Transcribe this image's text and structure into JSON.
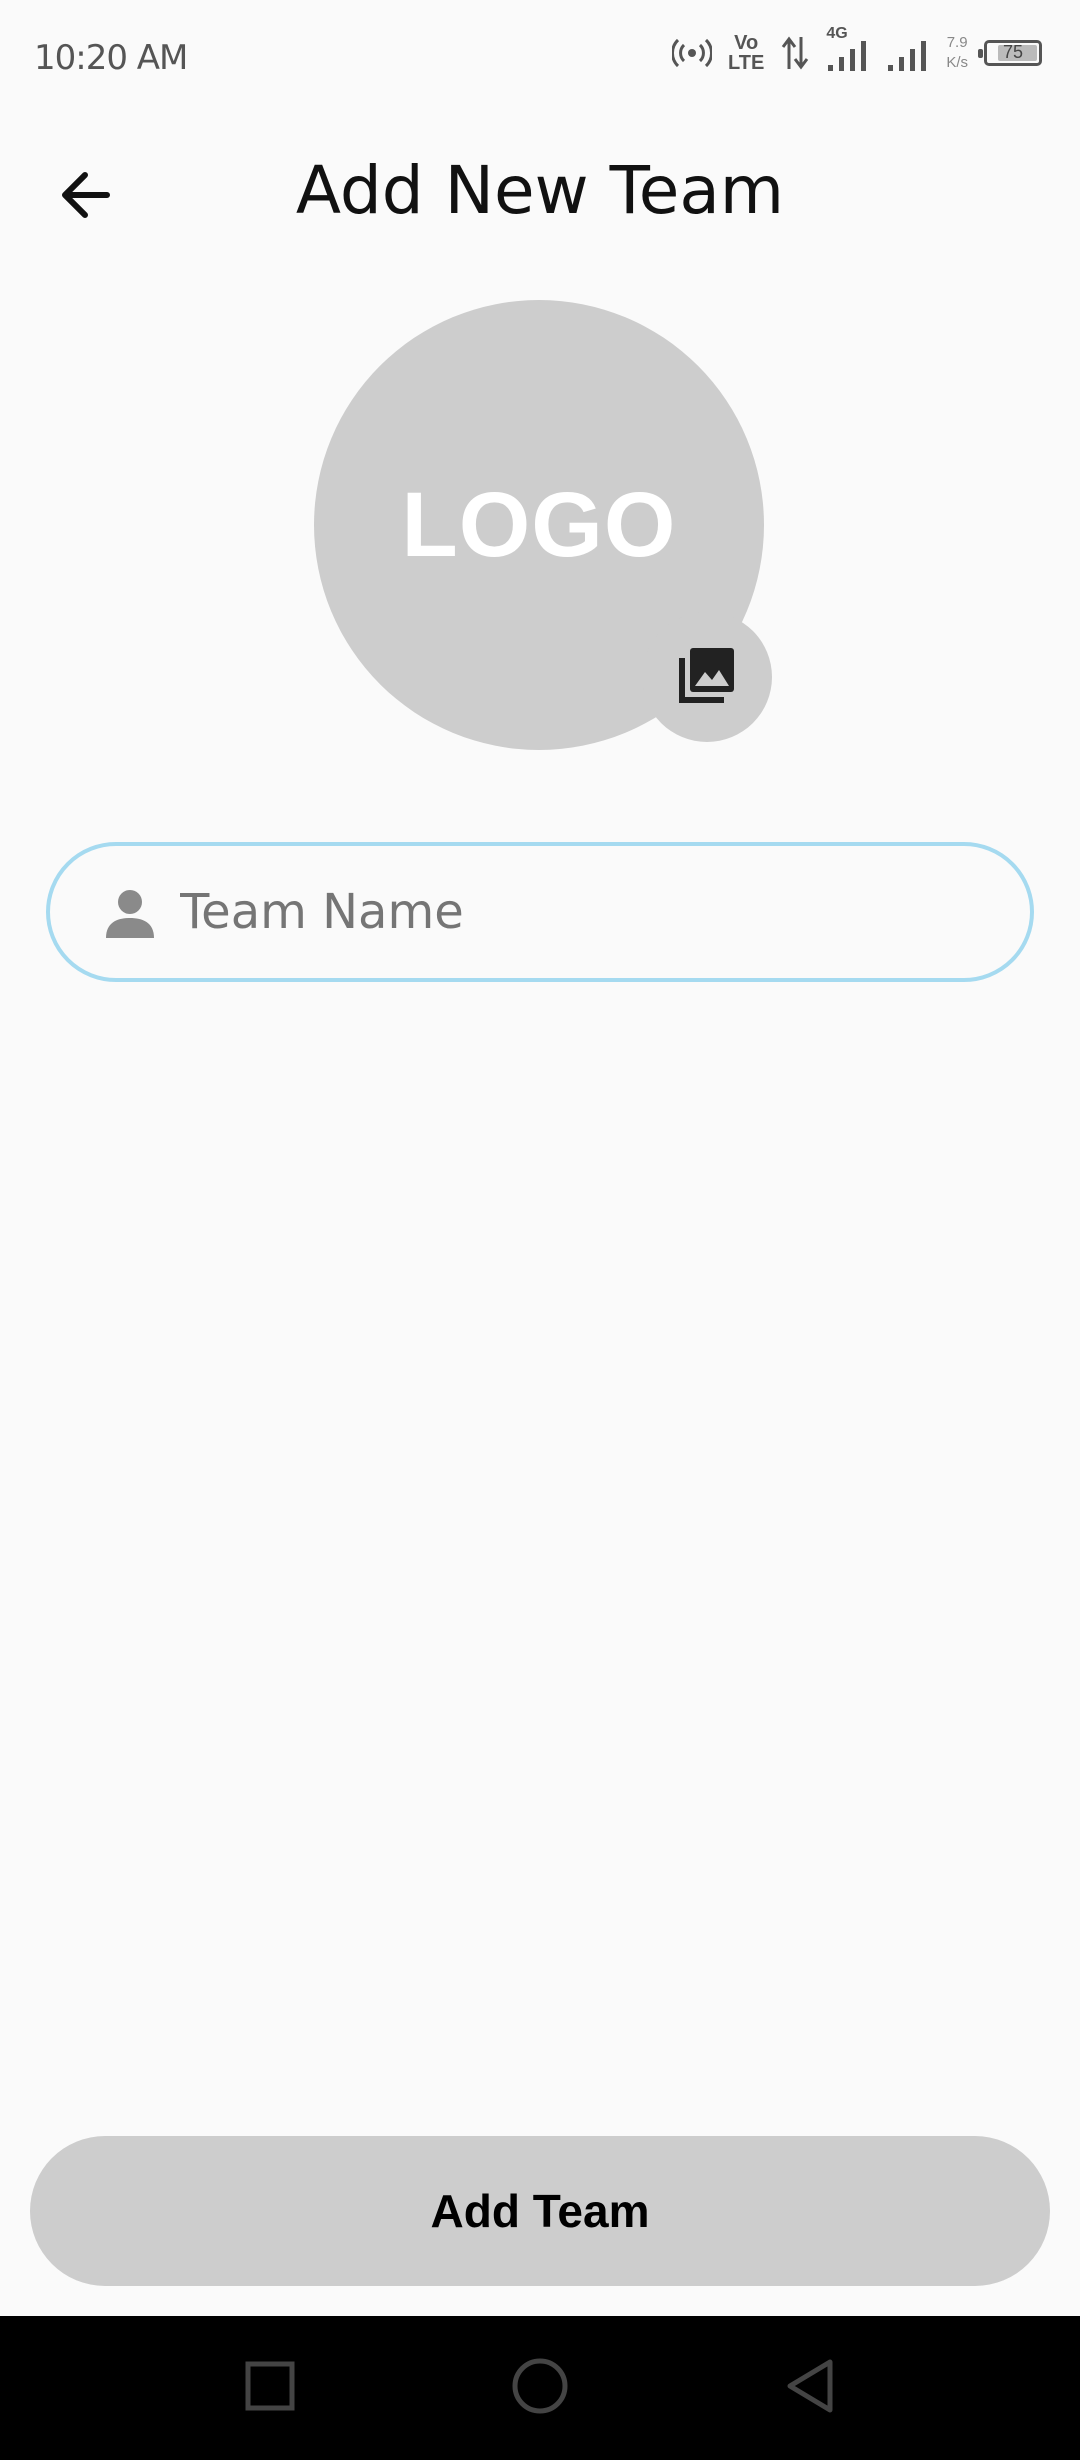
{
  "status_bar": {
    "time": "10:20 AM",
    "volte_top": "Vo",
    "volte_bottom": "LTE",
    "network": "4G",
    "speed_value": "7.9",
    "speed_unit": "K/s",
    "battery": "75"
  },
  "app_bar": {
    "title": "Add New Team",
    "back_icon": "arrow-back-icon"
  },
  "logo": {
    "placeholder_text": "LOGO",
    "picker_icon": "photo-library-icon"
  },
  "team_name_field": {
    "placeholder": "Team Name",
    "value": "",
    "icon": "person-icon",
    "border_color": "#a5daf0"
  },
  "actions": {
    "add_team_label": "Add Team"
  },
  "nav_bar": {
    "recents_icon": "square-icon",
    "home_icon": "circle-icon",
    "back_icon": "triangle-back-icon"
  },
  "colors": {
    "background": "#fafafa",
    "placeholder_gray": "#cdcdcd",
    "accent_border": "#a5daf0"
  }
}
